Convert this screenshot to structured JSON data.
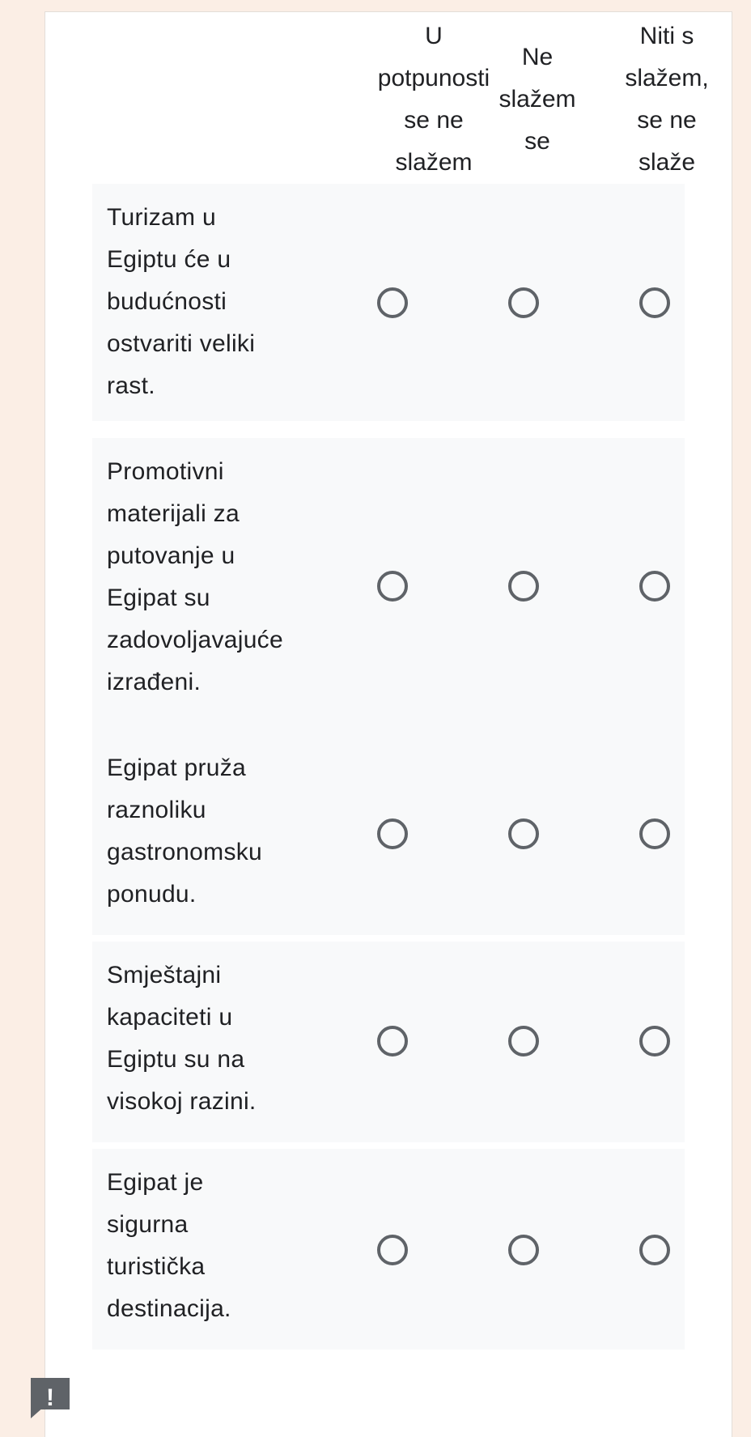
{
  "columns": [
    {
      "label": "U\npotpunosti\nse ne\nslažem"
    },
    {
      "label": "Ne\nslažem\nse"
    },
    {
      "label": "Niti s\nslažem,\nse ne\nslaže"
    }
  ],
  "rows": [
    {
      "label": "Turizam u\nEgiptu će u\nbudućnosti\nostvariti veliki\nrast."
    },
    {
      "label": "Promotivni\nmaterijali za\nputovanje u\nEgipat su\nzadovoljavajuće\nizrađeni."
    },
    {
      "label": "Egipat pruža\nraznoliku\ngastronomsku\nponudu."
    },
    {
      "label": "Smještajni\nkapaciteti u\nEgiptu su na\nvisokoj razini."
    },
    {
      "label": "Egipat je\nsigurna\nturistička\ndestinacija."
    }
  ],
  "alert_badge": {
    "symbol": "!",
    "icon": "alert-icon"
  }
}
